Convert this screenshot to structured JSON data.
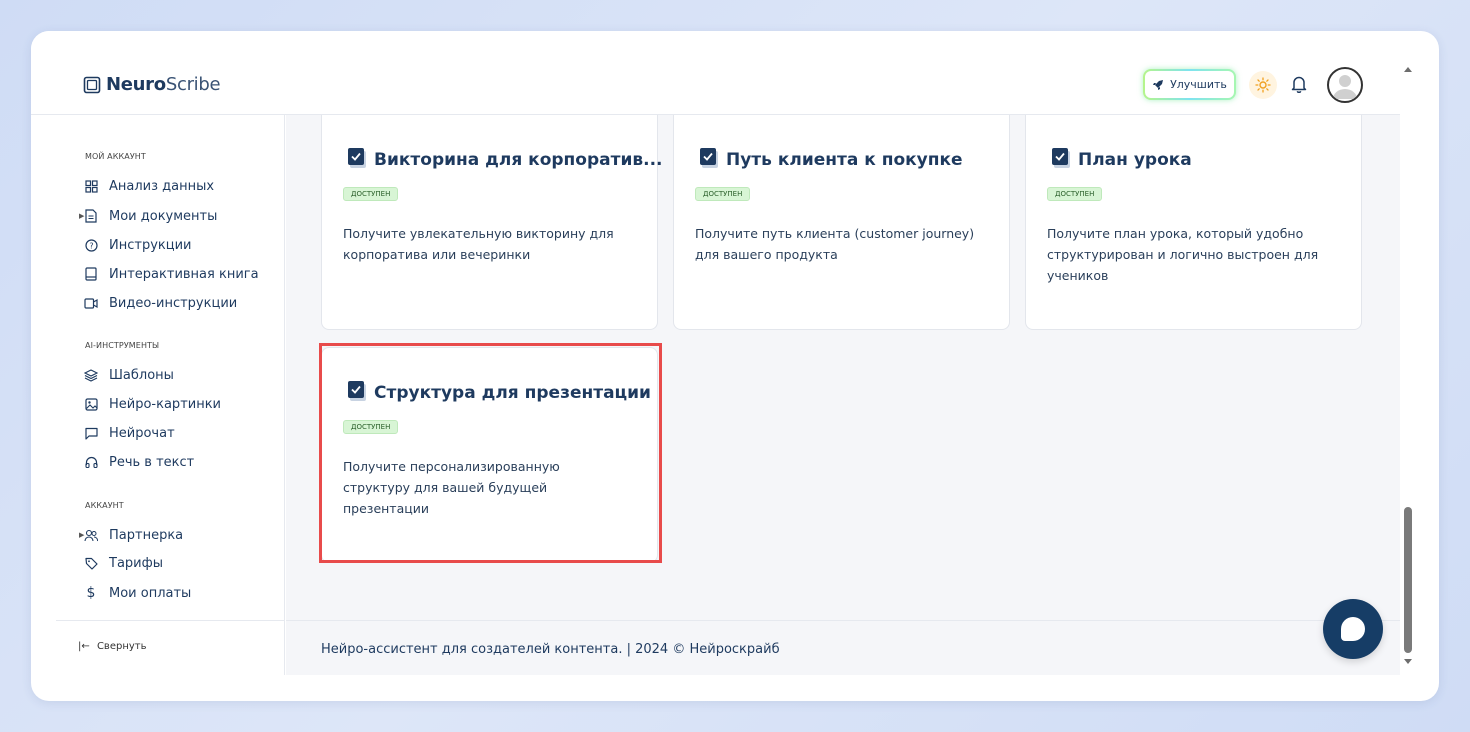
{
  "brand": {
    "name_bold": "Neuro",
    "name_light": "Scribe"
  },
  "header": {
    "upgrade_label": "Улучшить"
  },
  "sidebar": {
    "section_account": "МОЙ АККАУНТ",
    "section_ai": "AI-ИНСТРУМЕНТЫ",
    "section_profile": "АККАУНТ",
    "items": [
      {
        "label": "Анализ данных",
        "icon": "grid-icon"
      },
      {
        "label": "Мои документы",
        "icon": "document-icon"
      },
      {
        "label": "Инструкции",
        "icon": "help-circle-icon"
      },
      {
        "label": "Интерактивная книга",
        "icon": "book-icon"
      },
      {
        "label": "Видео-инструкции",
        "icon": "video-icon"
      },
      {
        "label": "Шаблоны",
        "icon": "layers-icon"
      },
      {
        "label": "Нейро-картинки",
        "icon": "image-icon"
      },
      {
        "label": "Нейрочат",
        "icon": "chat-icon"
      },
      {
        "label": "Речь в текст",
        "icon": "headphones-icon"
      },
      {
        "label": "Партнерка",
        "icon": "users-icon"
      },
      {
        "label": "Тарифы",
        "icon": "tag-icon"
      },
      {
        "label": "Мои оплаты",
        "icon": "dollar-icon"
      }
    ],
    "collapse_label": "Свернуть"
  },
  "cards": [
    {
      "title": "Викторина для корпоратив...",
      "badge": "ДОСТУПЕН",
      "desc": "Получите увлекательную викторину для корпоратива или вечеринки"
    },
    {
      "title": "Путь клиента к покупке",
      "badge": "ДОСТУПЕН",
      "desc": "Получите путь клиента (customer journey) для вашего продукта"
    },
    {
      "title": "План урока",
      "badge": "ДОСТУПЕН",
      "desc": "Получите план урока, который удобно структурирован и логично выстроен для учеников"
    },
    {
      "title": "Структура для презентации",
      "badge": "ДОСТУПЕН",
      "desc": "Получите персонализированную структуру для вашей будущей презентации"
    }
  ],
  "footer": {
    "text": "Нейро-ассистент для создателей контента.  | 2024 © Нейроскрайб"
  },
  "colors": {
    "accent": "#1e3a5f",
    "highlight": "#e84b4b",
    "chat": "#163d66"
  }
}
